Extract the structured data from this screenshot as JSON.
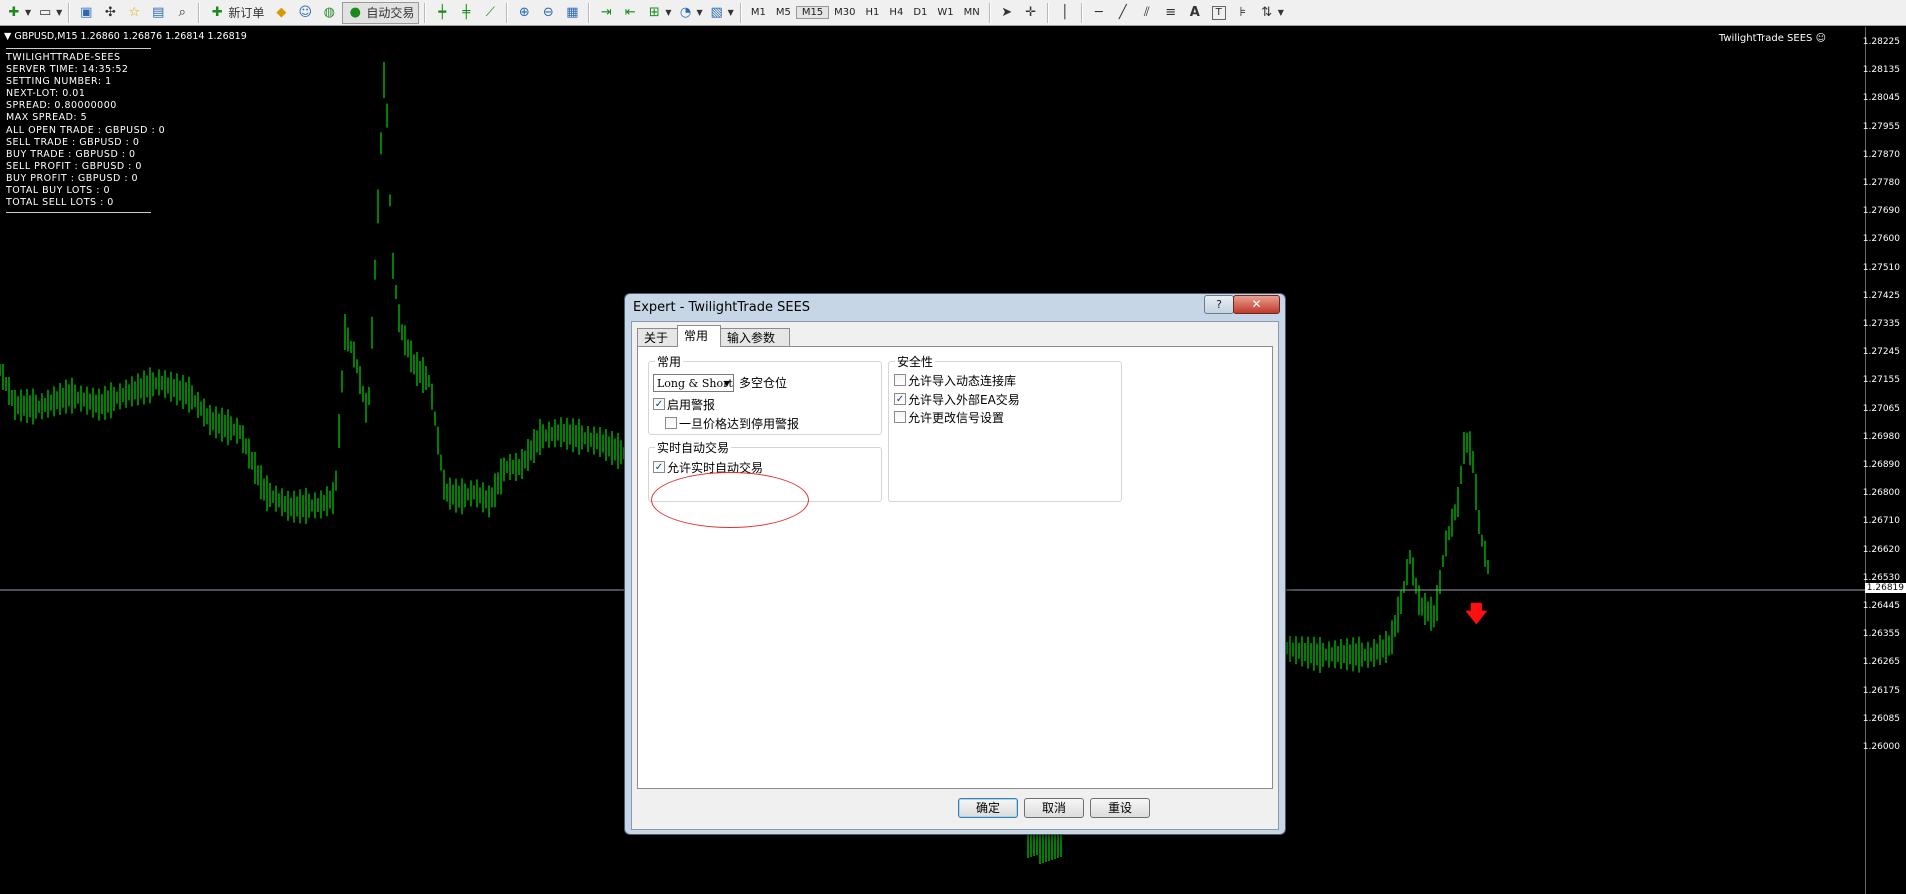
{
  "toolbar": {
    "new_order_label": "新订单",
    "auto_trading_label": "自动交易",
    "timeframes": [
      "M1",
      "M5",
      "M15",
      "M30",
      "H1",
      "H4",
      "D1",
      "W1",
      "MN"
    ]
  },
  "chart": {
    "symbol_header": "GBPUSD,M15  1.26860 1.26876 1.26814 1.26819",
    "ea_name_right": "TwilightTrade SEES ☺",
    "current_price": "1.26819",
    "price_levels": [
      "1.28225",
      "1.28135",
      "1.28045",
      "1.27955",
      "1.27870",
      "1.27780",
      "1.27690",
      "1.27600",
      "1.27510",
      "1.27425",
      "1.27335",
      "1.27245",
      "1.27155",
      "1.27065",
      "1.26980",
      "1.26890",
      "1.26800",
      "1.26710",
      "1.26620",
      "1.26530",
      "1.26445",
      "1.26355",
      "1.26265",
      "1.26175",
      "1.26085",
      "1.26000"
    ],
    "colors": {
      "candles": "#00ff00",
      "background": "#000000",
      "sell_arrow": "#ff0000"
    }
  },
  "info_panel": {
    "lines": [
      "TWILIGHTTRADE-SEES",
      "SERVER TIME:  14:35:52",
      "SETTING NUMBER:  1",
      "NEXT-LOT:  0.01",
      "SPREAD:  0.80000000",
      "MAX SPREAD:  5",
      "ALL OPEN TRADE : GBPUSD : 0",
      "SELL TRADE : GBPUSD : 0",
      "BUY TRADE : GBPUSD : 0",
      "SELL PROFIT : GBPUSD : 0",
      "BUY  PROFIT : GBPUSD : 0",
      "TOTAL BUY  LOTS : 0",
      "TOTAL SELL LOTS : 0"
    ]
  },
  "dialog": {
    "title": "Expert - TwilightTrade SEES",
    "help_label": "?",
    "close_label": "✕",
    "tabs": [
      "关于",
      "常用",
      "输入参数"
    ],
    "group_common": {
      "title": "常用",
      "position_select": "Long & Short",
      "position_label": "多空仓位",
      "enable_alerts": "启用警报",
      "disable_alert_on_price": "一旦价格达到停用警报"
    },
    "group_live": {
      "title": "实时自动交易",
      "allow_live_trading": "允许实时自动交易"
    },
    "group_safety": {
      "title": "安全性",
      "allow_dll": "允许导入动态连接库",
      "allow_external_ea": "允许导入外部EA交易",
      "allow_signal_modify": "允许更改信号设置"
    },
    "buttons": {
      "ok": "确定",
      "cancel": "取消",
      "reset": "重设"
    }
  }
}
